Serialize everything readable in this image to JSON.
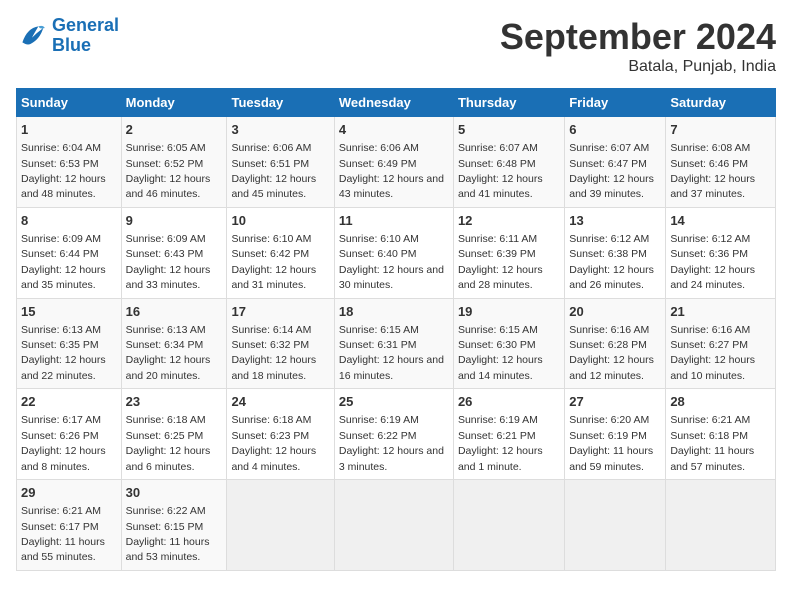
{
  "header": {
    "logo_line1": "General",
    "logo_line2": "Blue",
    "month": "September 2024",
    "location": "Batala, Punjab, India"
  },
  "days_of_week": [
    "Sunday",
    "Monday",
    "Tuesday",
    "Wednesday",
    "Thursday",
    "Friday",
    "Saturday"
  ],
  "weeks": [
    [
      {
        "day": "1",
        "sunrise": "6:04 AM",
        "sunset": "6:53 PM",
        "daylight": "12 hours and 48 minutes."
      },
      {
        "day": "2",
        "sunrise": "6:05 AM",
        "sunset": "6:52 PM",
        "daylight": "12 hours and 46 minutes."
      },
      {
        "day": "3",
        "sunrise": "6:06 AM",
        "sunset": "6:51 PM",
        "daylight": "12 hours and 45 minutes."
      },
      {
        "day": "4",
        "sunrise": "6:06 AM",
        "sunset": "6:49 PM",
        "daylight": "12 hours and 43 minutes."
      },
      {
        "day": "5",
        "sunrise": "6:07 AM",
        "sunset": "6:48 PM",
        "daylight": "12 hours and 41 minutes."
      },
      {
        "day": "6",
        "sunrise": "6:07 AM",
        "sunset": "6:47 PM",
        "daylight": "12 hours and 39 minutes."
      },
      {
        "day": "7",
        "sunrise": "6:08 AM",
        "sunset": "6:46 PM",
        "daylight": "12 hours and 37 minutes."
      }
    ],
    [
      {
        "day": "8",
        "sunrise": "6:09 AM",
        "sunset": "6:44 PM",
        "daylight": "12 hours and 35 minutes."
      },
      {
        "day": "9",
        "sunrise": "6:09 AM",
        "sunset": "6:43 PM",
        "daylight": "12 hours and 33 minutes."
      },
      {
        "day": "10",
        "sunrise": "6:10 AM",
        "sunset": "6:42 PM",
        "daylight": "12 hours and 31 minutes."
      },
      {
        "day": "11",
        "sunrise": "6:10 AM",
        "sunset": "6:40 PM",
        "daylight": "12 hours and 30 minutes."
      },
      {
        "day": "12",
        "sunrise": "6:11 AM",
        "sunset": "6:39 PM",
        "daylight": "12 hours and 28 minutes."
      },
      {
        "day": "13",
        "sunrise": "6:12 AM",
        "sunset": "6:38 PM",
        "daylight": "12 hours and 26 minutes."
      },
      {
        "day": "14",
        "sunrise": "6:12 AM",
        "sunset": "6:36 PM",
        "daylight": "12 hours and 24 minutes."
      }
    ],
    [
      {
        "day": "15",
        "sunrise": "6:13 AM",
        "sunset": "6:35 PM",
        "daylight": "12 hours and 22 minutes."
      },
      {
        "day": "16",
        "sunrise": "6:13 AM",
        "sunset": "6:34 PM",
        "daylight": "12 hours and 20 minutes."
      },
      {
        "day": "17",
        "sunrise": "6:14 AM",
        "sunset": "6:32 PM",
        "daylight": "12 hours and 18 minutes."
      },
      {
        "day": "18",
        "sunrise": "6:15 AM",
        "sunset": "6:31 PM",
        "daylight": "12 hours and 16 minutes."
      },
      {
        "day": "19",
        "sunrise": "6:15 AM",
        "sunset": "6:30 PM",
        "daylight": "12 hours and 14 minutes."
      },
      {
        "day": "20",
        "sunrise": "6:16 AM",
        "sunset": "6:28 PM",
        "daylight": "12 hours and 12 minutes."
      },
      {
        "day": "21",
        "sunrise": "6:16 AM",
        "sunset": "6:27 PM",
        "daylight": "12 hours and 10 minutes."
      }
    ],
    [
      {
        "day": "22",
        "sunrise": "6:17 AM",
        "sunset": "6:26 PM",
        "daylight": "12 hours and 8 minutes."
      },
      {
        "day": "23",
        "sunrise": "6:18 AM",
        "sunset": "6:25 PM",
        "daylight": "12 hours and 6 minutes."
      },
      {
        "day": "24",
        "sunrise": "6:18 AM",
        "sunset": "6:23 PM",
        "daylight": "12 hours and 4 minutes."
      },
      {
        "day": "25",
        "sunrise": "6:19 AM",
        "sunset": "6:22 PM",
        "daylight": "12 hours and 3 minutes."
      },
      {
        "day": "26",
        "sunrise": "6:19 AM",
        "sunset": "6:21 PM",
        "daylight": "12 hours and 1 minute."
      },
      {
        "day": "27",
        "sunrise": "6:20 AM",
        "sunset": "6:19 PM",
        "daylight": "11 hours and 59 minutes."
      },
      {
        "day": "28",
        "sunrise": "6:21 AM",
        "sunset": "6:18 PM",
        "daylight": "11 hours and 57 minutes."
      }
    ],
    [
      {
        "day": "29",
        "sunrise": "6:21 AM",
        "sunset": "6:17 PM",
        "daylight": "11 hours and 55 minutes."
      },
      {
        "day": "30",
        "sunrise": "6:22 AM",
        "sunset": "6:15 PM",
        "daylight": "11 hours and 53 minutes."
      },
      null,
      null,
      null,
      null,
      null
    ]
  ]
}
